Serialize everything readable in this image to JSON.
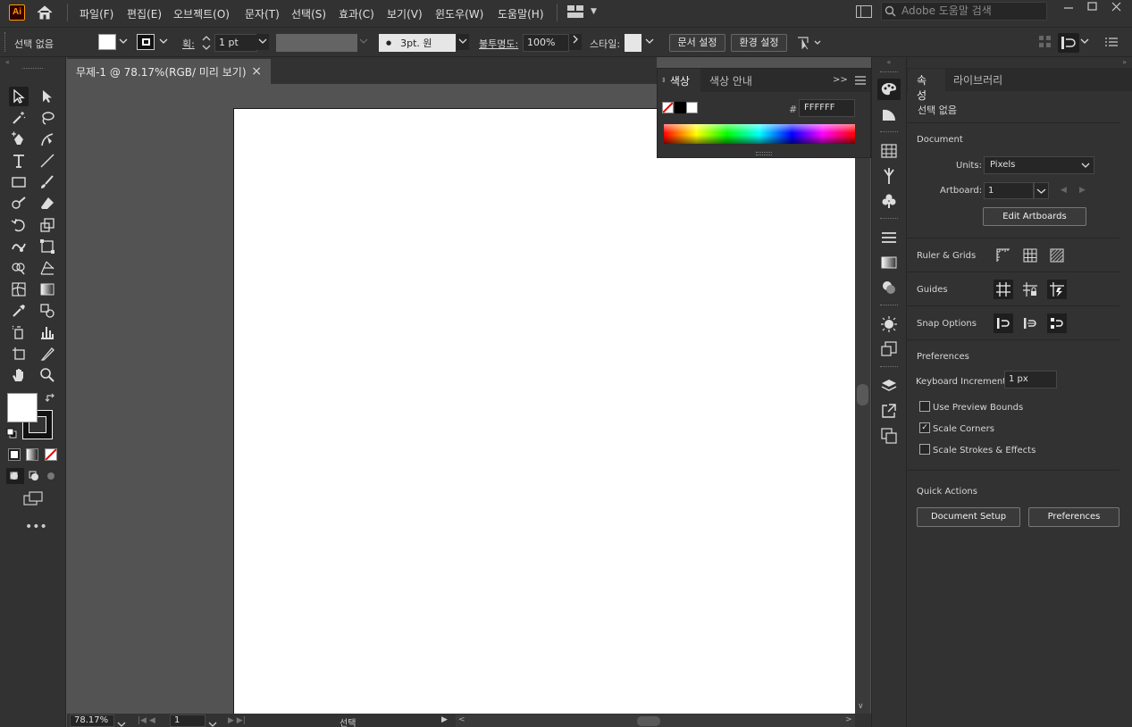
{
  "app": {
    "logo_text": "Ai"
  },
  "menu": {
    "items": [
      "파일(F)",
      "편집(E)",
      "오브젝트(O)",
      "문자(T)",
      "선택(S)",
      "효과(C)",
      "보기(V)",
      "윈도우(W)",
      "도움말(H)"
    ],
    "search_placeholder": "Adobe 도움말 검색"
  },
  "control": {
    "selection_label": "선택 없음",
    "stroke_label": "획:",
    "stroke_weight": "1 pt",
    "brush_label": "3pt. 원",
    "opacity_label": "불투명도:",
    "opacity_value": "100%",
    "style_label": "스타일:",
    "doc_setup_btn": "문서 설정",
    "prefs_btn": "환경 설정"
  },
  "document": {
    "tab_title": "무제-1 @ 78.17%(RGB/ 미리 보기)",
    "close_glyph": "×"
  },
  "color_panel": {
    "tabs": [
      "색상",
      "색상 안내"
    ],
    "hex_label": "#",
    "hex_value": "FFFFFF",
    "expand_glyph": ">>"
  },
  "status": {
    "zoom": "78.17%",
    "artboard": "1",
    "tool_label": "선택"
  },
  "properties": {
    "tabs": [
      "속성",
      "라이브러리"
    ],
    "selection": "선택 없음",
    "document_heading": "Document",
    "units_label": "Units:",
    "units_value": "Pixels",
    "artboard_label": "Artboard:",
    "artboard_value": "1",
    "edit_artboards_btn": "Edit Artboards",
    "ruler_grids_label": "Ruler & Grids",
    "guides_label": "Guides",
    "snap_label": "Snap Options",
    "prefs_heading": "Preferences",
    "kb_inc_label": "Keyboard Increment:",
    "kb_inc_value": "1 px",
    "use_preview_bounds": {
      "label": "Use Preview Bounds",
      "checked": false
    },
    "scale_corners": {
      "label": "Scale Corners",
      "checked": true
    },
    "scale_strokes": {
      "label": "Scale Strokes & Effects",
      "checked": false
    },
    "quick_actions_heading": "Quick Actions",
    "doc_setup_btn": "Document Setup",
    "prefs_btn": "Preferences"
  },
  "colors": {
    "chrome": "#323232",
    "canvas": "#535353",
    "accent": "#ff9a00"
  }
}
